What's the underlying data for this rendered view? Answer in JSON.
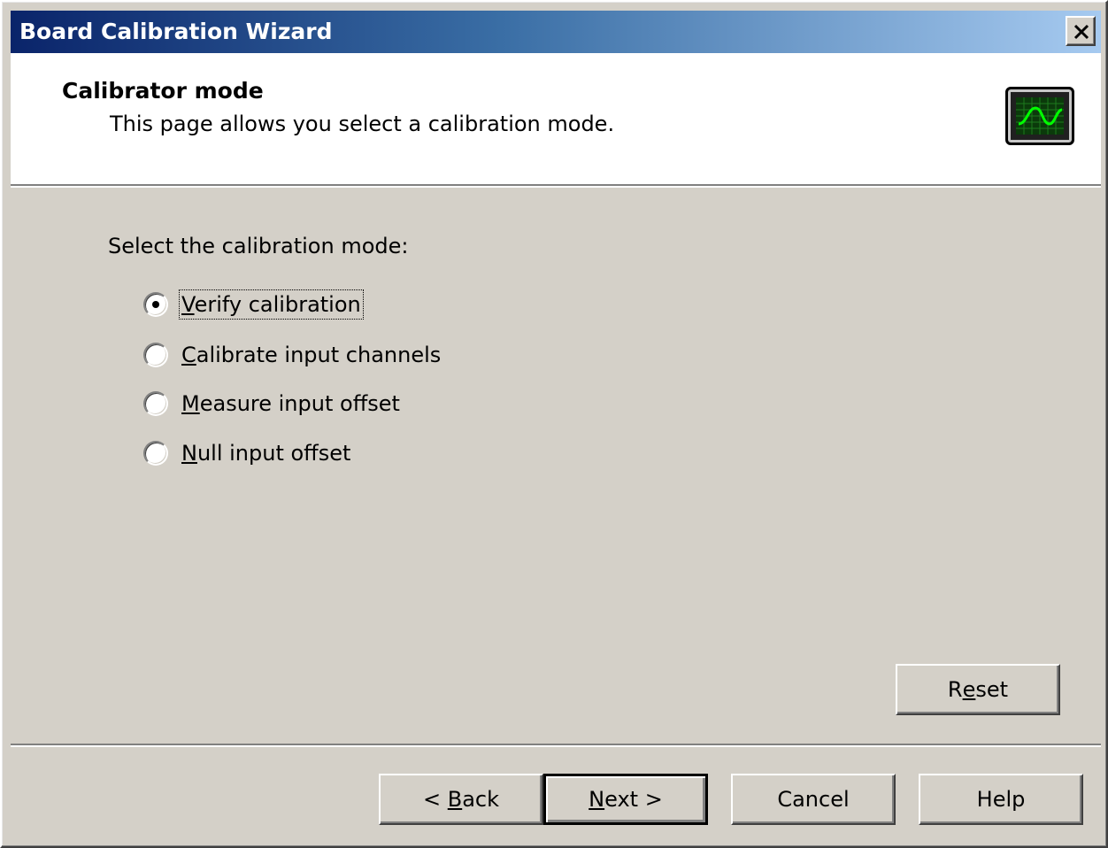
{
  "window": {
    "title": "Board Calibration Wizard",
    "close_glyph": "close-icon"
  },
  "header": {
    "title": "Calibrator mode",
    "subtitle": "This page allows you select a calibration mode.",
    "icon": "oscilloscope-icon"
  },
  "content": {
    "prompt": "Select the calibration mode:",
    "options": [
      {
        "label_pre": "",
        "label_u": "V",
        "label_post": "erify calibration",
        "selected": true
      },
      {
        "label_pre": "",
        "label_u": "C",
        "label_post": "alibrate input channels",
        "selected": false
      },
      {
        "label_pre": "",
        "label_u": "M",
        "label_post": "easure input offset",
        "selected": false
      },
      {
        "label_pre": "",
        "label_u": "N",
        "label_post": "ull input offset",
        "selected": false
      }
    ],
    "reset": {
      "pre": "R",
      "u": "e",
      "post": "set"
    }
  },
  "footer": {
    "back": {
      "pre": "< ",
      "u": "B",
      "post": "ack"
    },
    "next": {
      "pre": "",
      "u": "N",
      "post": "ext >"
    },
    "cancel": "Cancel",
    "help": "Help"
  },
  "colors": {
    "titlebar_start": "#0a246a",
    "titlebar_end": "#a6caf0",
    "face": "#d4d0c8",
    "scope_trace": "#00ff00"
  }
}
